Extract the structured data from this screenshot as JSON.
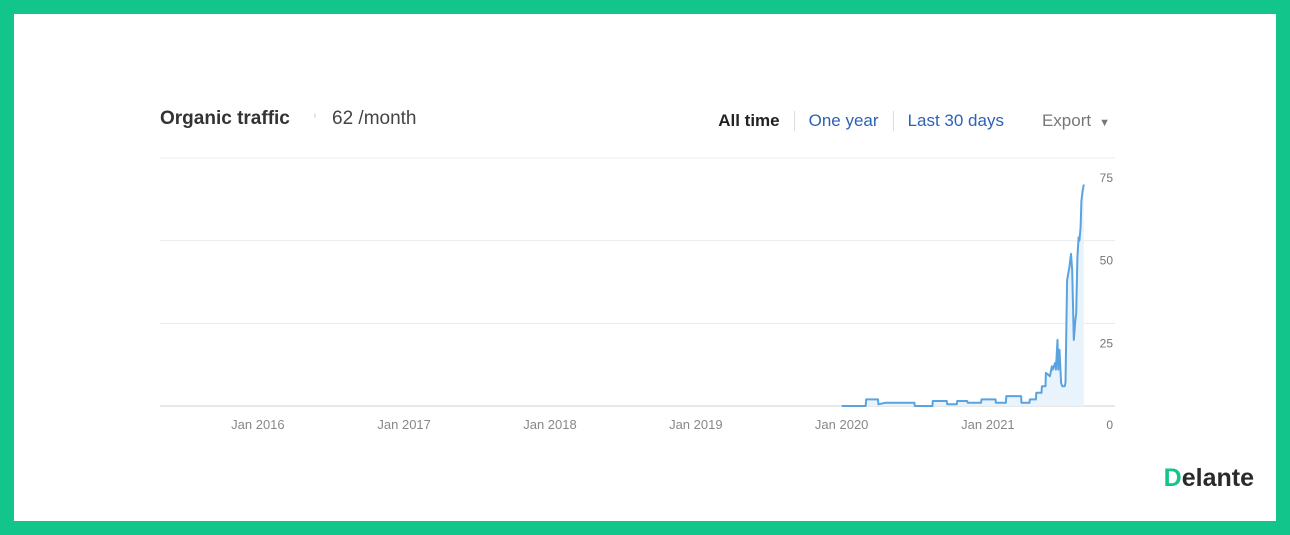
{
  "header": {
    "title": "Organic traffic",
    "info_icon": "info-icon",
    "metric": "62 /month",
    "ranges": [
      "All time",
      "One year",
      "Last 30 days"
    ],
    "active_range": "All time",
    "export_label": "Export"
  },
  "brand": {
    "logo_text": "elante",
    "logo_initial": "D"
  },
  "colors": {
    "frame": "#12c58a",
    "line": "#5aa3e0",
    "fill": "#e9f3fc",
    "link": "#2d62b5"
  },
  "chart_data": {
    "type": "area",
    "title": "",
    "xlabel": "",
    "ylabel": "",
    "x_tick_labels": [
      "Jan 2016",
      "Jan 2017",
      "Jan 2018",
      "Jan 2019",
      "Jan 2020",
      "Jan 2021"
    ],
    "x_tick_dates": [
      "2016-01-01",
      "2017-01-01",
      "2018-01-01",
      "2019-01-01",
      "2020-01-01",
      "2021-01-01"
    ],
    "xlim": [
      "2015-05-01",
      "2021-11-15"
    ],
    "y_ticks": [
      0,
      25,
      50,
      75
    ],
    "ylim": [
      0,
      75
    ],
    "grid": true,
    "y_axis_side": "right",
    "series": [
      {
        "x": [
          "2020-01-01",
          "2020-03-01",
          "2020-03-02",
          "2020-04-01",
          "2020-04-02",
          "2020-04-20",
          "2020-07-01",
          "2020-07-02",
          "2020-08-15",
          "2020-08-16",
          "2020-09-20",
          "2020-09-21",
          "2020-10-15",
          "2020-10-16",
          "2020-11-10",
          "2020-11-11",
          "2020-12-15",
          "2020-12-16",
          "2021-01-20",
          "2021-01-21",
          "2021-02-15",
          "2021-02-16",
          "2021-03-25",
          "2021-03-26",
          "2021-04-15",
          "2021-04-16",
          "2021-05-01",
          "2021-05-02",
          "2021-05-15",
          "2021-05-16",
          "2021-05-25",
          "2021-05-26",
          "2021-06-05",
          "2021-06-10",
          "2021-06-12",
          "2021-06-18",
          "2021-06-20",
          "2021-06-24",
          "2021-06-26",
          "2021-06-29",
          "2021-07-03",
          "2021-07-06",
          "2021-07-12",
          "2021-07-14",
          "2021-07-18",
          "2021-07-24",
          "2021-07-26",
          "2021-07-28",
          "2021-07-31",
          "2021-08-04",
          "2021-08-08",
          "2021-08-10",
          "2021-08-13",
          "2021-08-16",
          "2021-08-18",
          "2021-08-21",
          "2021-08-23",
          "2021-08-26",
          "2021-08-29"
        ],
        "y": [
          0,
          0,
          2,
          2,
          0.5,
          1,
          1,
          0,
          0,
          1.5,
          1.5,
          0.5,
          0.5,
          1.5,
          1.5,
          1,
          1,
          2,
          2,
          1,
          1,
          3,
          3,
          1,
          1,
          2,
          2,
          4,
          4,
          6,
          6,
          10,
          9,
          12,
          11,
          13,
          11,
          20,
          11,
          17,
          7,
          6,
          6,
          7,
          38,
          42,
          44,
          46,
          41,
          20,
          26,
          28,
          45,
          51,
          50,
          54,
          62,
          65,
          67
        ]
      }
    ]
  }
}
